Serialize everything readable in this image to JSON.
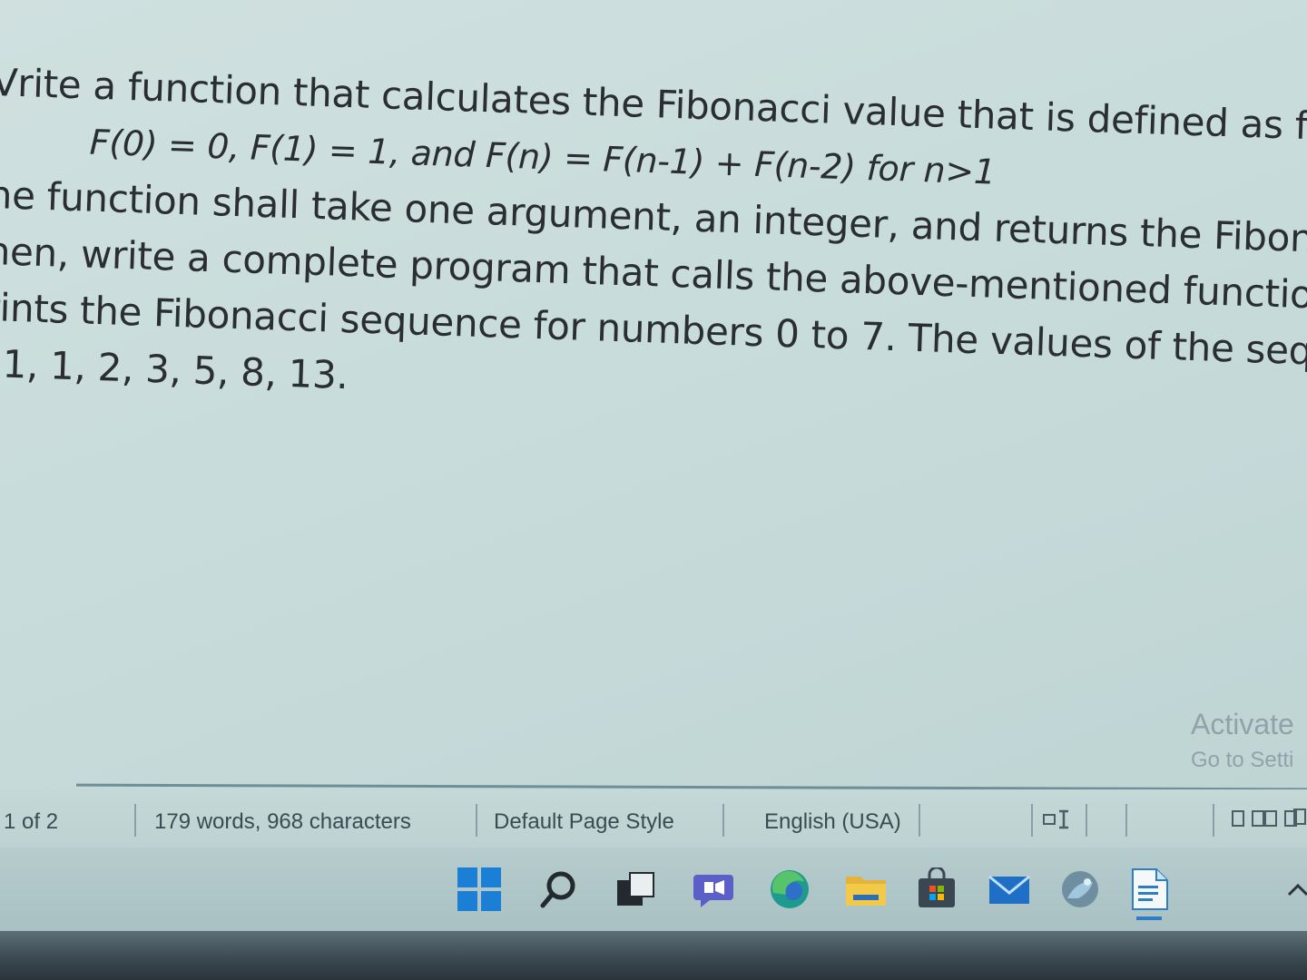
{
  "document": {
    "lines": [
      "Vrite a function that calculates the Fibonacci value that is defined as follow",
      "F(0) = 0, F(1) = 1, and F(n) = F(n-1) + F(n-2)  for n>1",
      "he function shall take one argument, an integer, and returns the Fibonacci",
      "hen, write a complete program that calls the above-mentioned function a",
      "rints the Fibonacci sequence for numbers 0 to 7. The values of the sequen",
      "1, 1, 2, 3, 5, 8, 13."
    ]
  },
  "watermark": {
    "title": "Activate",
    "subtitle": "Go to Setti"
  },
  "statusbar": {
    "page": "1 of 2",
    "word_count": "179 words, 968 characters",
    "page_style": "Default Page Style",
    "language": "English (USA)",
    "mode_icon": "insert-mode-icon",
    "view_icon": "page-view-icon"
  },
  "taskbar": {
    "icons": [
      "windows-start-icon",
      "search-icon",
      "task-view-icon",
      "teams-chat-icon",
      "edge-browser-icon",
      "file-explorer-icon",
      "microsoft-store-icon",
      "mail-icon",
      "photos-icon",
      "libreoffice-writer-icon",
      "chevron-up-icon"
    ],
    "active_app": "libreoffice-writer-icon"
  },
  "colors": {
    "text": "#2a2e33",
    "background": "#c8dcdb",
    "status_text": "#3c4a52",
    "windows_blue": "#1c7fd6",
    "edge_teal": "#1f9a8e"
  }
}
